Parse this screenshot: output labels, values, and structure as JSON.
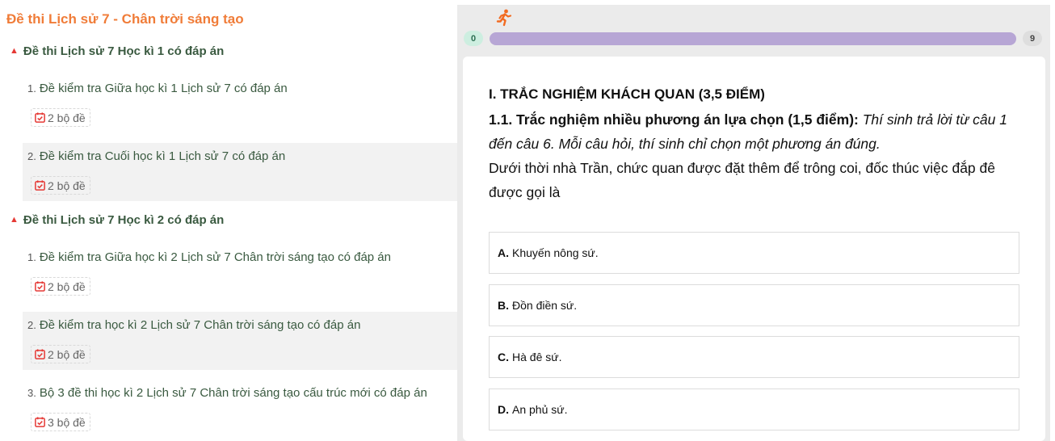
{
  "left": {
    "title": "Đề thi Lịch sử 7 - Chân trời sáng tạo",
    "sections": [
      {
        "heading": "Đề thi Lịch sử 7 Học kì 1 có đáp án",
        "items": [
          {
            "num": "1.",
            "title": "Đề kiểm tra Giữa học kì 1 Lịch sử 7 có đáp án",
            "badge": "2 bộ đề"
          },
          {
            "num": "2.",
            "title": "Đề kiểm tra Cuối học kì 1 Lịch sử 7 có đáp án",
            "badge": "2 bộ đề"
          }
        ]
      },
      {
        "heading": "Đề thi Lịch sử 7 Học kì 2 có đáp án",
        "items": [
          {
            "num": "1.",
            "title": "Đề kiểm tra Giữa học kì 2 Lịch sử 7 Chân trời sáng tạo có đáp án",
            "badge": "2 bộ đề"
          },
          {
            "num": "2.",
            "title": "Đề kiểm tra học kì 2 Lịch sử 7 Chân trời sáng tạo có đáp án",
            "badge": "2 bộ đề"
          },
          {
            "num": "3.",
            "title": "Bộ 3 đề thi học kì 2 Lịch sử 7 Chân trời sáng tạo cấu trúc mới có đáp án",
            "badge": "3 bộ đề"
          }
        ]
      }
    ]
  },
  "quiz": {
    "progress": {
      "start": "0",
      "end": "9",
      "fraction": 0.0
    },
    "section_title": "I. TRẮC NGHIỆM KHÁCH QUAN (3,5 ĐIỂM)",
    "subsection": "1.1. Trắc nghiệm nhiều phương án lựa chọn (1,5 điểm):",
    "instruction": "Thí sinh trả lời từ câu 1 đến câu 6. Mỗi câu hỏi, thí sinh chỉ chọn một phương án đúng.",
    "question": "Dưới thời nhà Trần, chức quan được đặt thêm để trông coi, đốc thúc việc đắp đê được gọi là",
    "options": [
      {
        "label": "A.",
        "text": "Khuyến nông sứ."
      },
      {
        "label": "B.",
        "text": "Đồn điền sứ."
      },
      {
        "label": "C.",
        "text": "Hà đê sứ."
      },
      {
        "label": "D.",
        "text": "An phủ sứ."
      }
    ]
  },
  "colors": {
    "title_orange": "#f07c38",
    "text_green": "#3a5a40",
    "chevron_red": "#e53935",
    "progress_purple": "#b7a6d5",
    "runner_orange": "#f26b21",
    "calendar_red": "#e53935"
  },
  "icons": {
    "runner": "running-person-icon",
    "chevron": "chevron-up-icon",
    "calendar": "calendar-check-icon"
  }
}
